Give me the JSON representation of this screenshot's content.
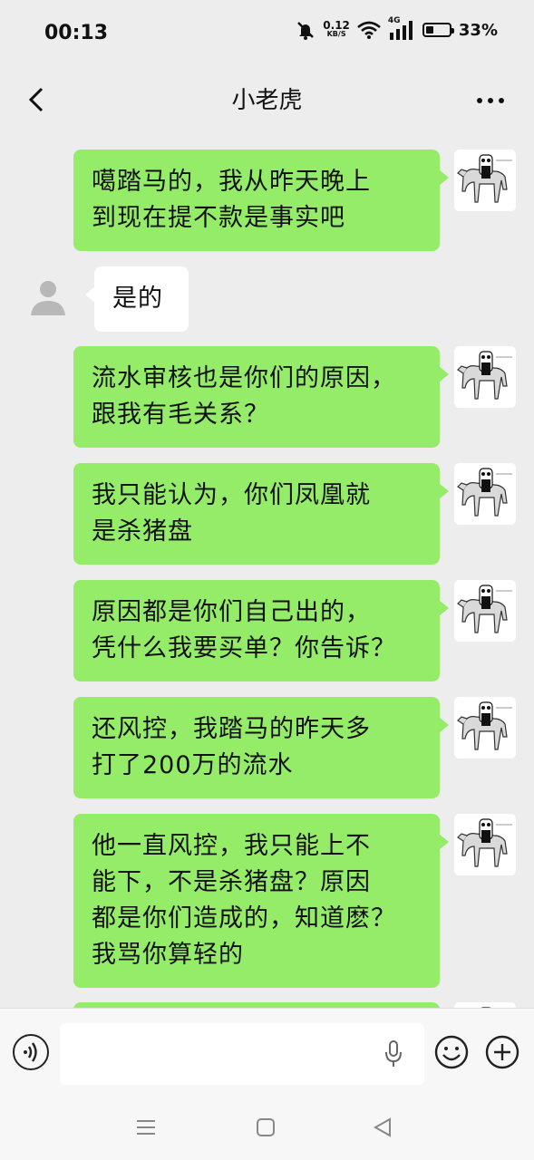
{
  "status_bar": {
    "time": "00:13",
    "net_speed_value": "0.12",
    "net_speed_unit": "KB/S",
    "network_type": "4G",
    "battery_percent": "33%",
    "battery_level": 0.33
  },
  "header": {
    "title": "小老虎"
  },
  "messages": [
    {
      "side": "out",
      "text": "噶踏马的，我从昨天晚上\n到现在提不款是事实吧"
    },
    {
      "side": "in",
      "text": "是的"
    },
    {
      "side": "out",
      "text": "流水审核也是你们的原因，\n跟我有毛关系？"
    },
    {
      "side": "out",
      "text": "我只能认为，你们凤凰就\n是杀猪盘"
    },
    {
      "side": "out",
      "text": "原因都是你们自己出的，\n凭什么我要买单？你告诉？"
    },
    {
      "side": "out",
      "text": "还风控，我踏马的昨天多\n打了200万的流水"
    },
    {
      "side": "out",
      "text": "他一直风控，我只能上不\n能下，不是杀猪盘？原因\n都是你们造成的，知道麽？\n我骂你算轻的"
    }
  ],
  "input": {
    "placeholder": ""
  },
  "icons": {
    "back": "chevron-left-icon",
    "more": "more-dots-icon",
    "voice": "voice-icon",
    "mic": "microphone-icon",
    "emoji": "emoji-icon",
    "plus": "plus-icon"
  }
}
